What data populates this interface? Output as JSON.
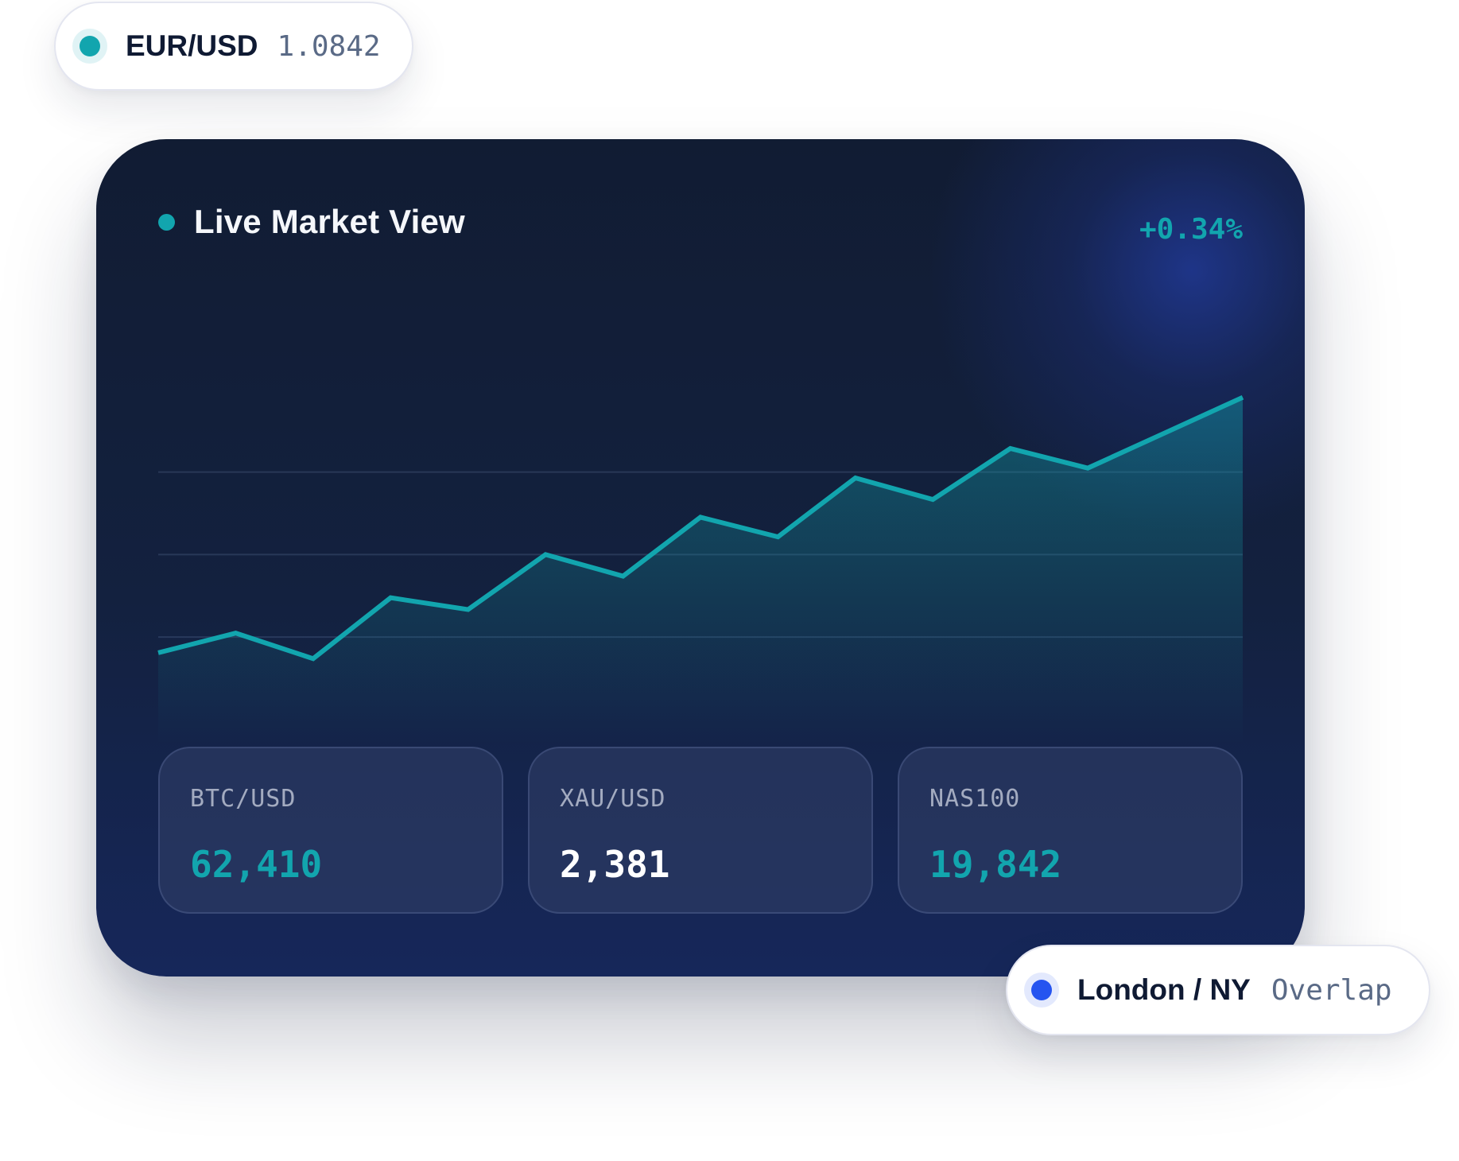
{
  "top_pill": {
    "label": "EUR/USD",
    "value": "1.0842",
    "dot_color": "#12a5ae"
  },
  "card": {
    "title": "Live Market View",
    "change": "+0.34%",
    "accent_color": "#12a5ae"
  },
  "chart_data": {
    "type": "area",
    "x": [
      0,
      1,
      2,
      3,
      4,
      5,
      6,
      7,
      8,
      9,
      10,
      11,
      12,
      13,
      14
    ],
    "series": [
      {
        "values": [
          1.0,
          1.5,
          0.85,
          2.4,
          2.1,
          3.5,
          2.95,
          4.45,
          3.95,
          5.45,
          4.9,
          6.2,
          5.7,
          6.6,
          7.5
        ]
      }
    ],
    "ylim": [
      -0.5,
      8
    ],
    "grid": true,
    "line_color": "#12a5ae",
    "xlabel": "",
    "ylabel": ""
  },
  "tiles": [
    {
      "label": "BTC/USD",
      "value": "62,410",
      "value_color": "#12a5ae"
    },
    {
      "label": "XAU/USD",
      "value": "2,381",
      "value_color": "#ffffff"
    },
    {
      "label": "NAS100",
      "value": "19,842",
      "value_color": "#12a5ae"
    }
  ],
  "bottom_pill": {
    "label": "London / NY",
    "value": "Overlap",
    "dot_color": "#2554f0"
  }
}
